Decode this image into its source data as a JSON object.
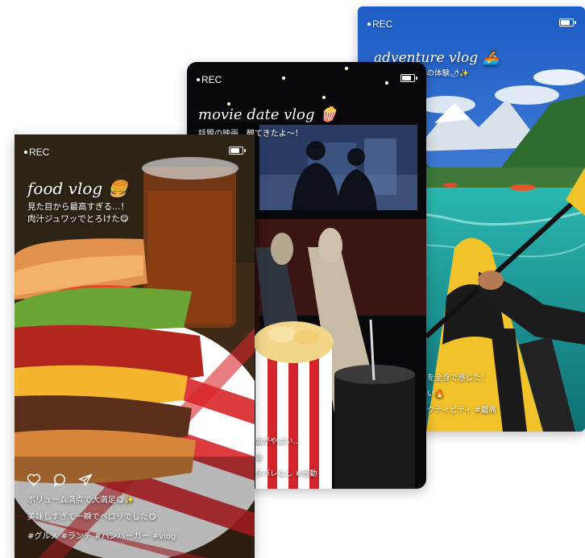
{
  "colors": {
    "food_bg": "#5a3a22",
    "movie_bg": "#0c0c14",
    "adventure_sky": "#2d6fd1",
    "river": "#1fa7a1",
    "kayak": "#f2c22a"
  },
  "cards": {
    "adventure": {
      "rec": "REC",
      "title": "adventure vlog 🚣",
      "subtitle": "高の体験🌶✨",
      "caption_lines": [
        "を全身で感じた！",
        "い🔥",
        "クティビティ #最高"
      ]
    },
    "movie": {
      "rec": "REC",
      "title": "movie date vlog 🍿",
      "subtitle": "話題の映画、観てきたよ〜！",
      "caption_lines": [
        "面がやばい…",
        "😆",
        "タバレなし #感動"
      ]
    },
    "food": {
      "rec": "REC",
      "title": "food vlog 🍔",
      "subtitle_lines": [
        "見た目から最高すぎる…！",
        "肉汁ジュワッでとろけた😋"
      ],
      "icons": [
        "heart-icon",
        "comment-icon",
        "send-icon"
      ],
      "caption_lines": [
        "ボリューム満点で大満足😋✨",
        "美味しすぎて一瞬でペロリでした😋",
        "#グルメ #ランチ #ハンバーガー #vlog"
      ]
    }
  }
}
